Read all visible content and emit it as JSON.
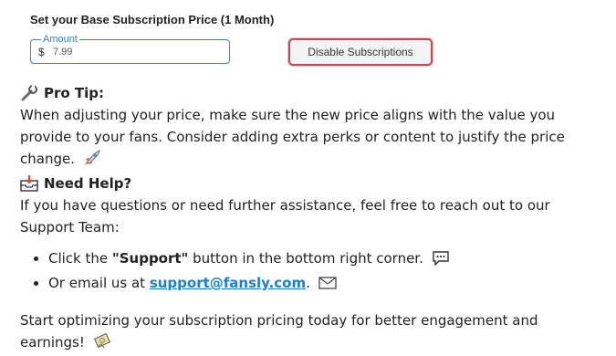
{
  "subscription": {
    "title": "Set your Base Subscription Price (1 Month)",
    "amount_label": "Amount",
    "currency_symbol": "$",
    "amount_value": "7.99",
    "disable_button": "Disable Subscriptions"
  },
  "pro_tip": {
    "heading": "Pro Tip:",
    "text": "When adjusting your price, make sure the new price aligns with the value you provide to your fans. Consider adding extra perks or content to justify the price change."
  },
  "need_help": {
    "heading": "Need Help?",
    "text": "If you have questions or need further assistance, feel free to reach out to our Support Team:"
  },
  "bullets": {
    "b1_prefix": "Click the ",
    "b1_bold": "\"Support\"",
    "b1_suffix": " button in the bottom right corner.",
    "b2_prefix": "Or email us at ",
    "b2_link": "support@fansly.com",
    "b2_suffix": "."
  },
  "closing": "Start optimizing your subscription pricing today for better engagement and earnings!",
  "icons": {
    "pro_tip": "wrench-icon",
    "need_help": "inbox-icon",
    "rocket": "rocket-icon",
    "chat": "speech-bubble-icon",
    "email": "envelope-icon",
    "money": "money-icon"
  },
  "colors": {
    "field_border": "#3b82c4",
    "button_border": "#c44b55",
    "link": "#1a7fd0"
  }
}
